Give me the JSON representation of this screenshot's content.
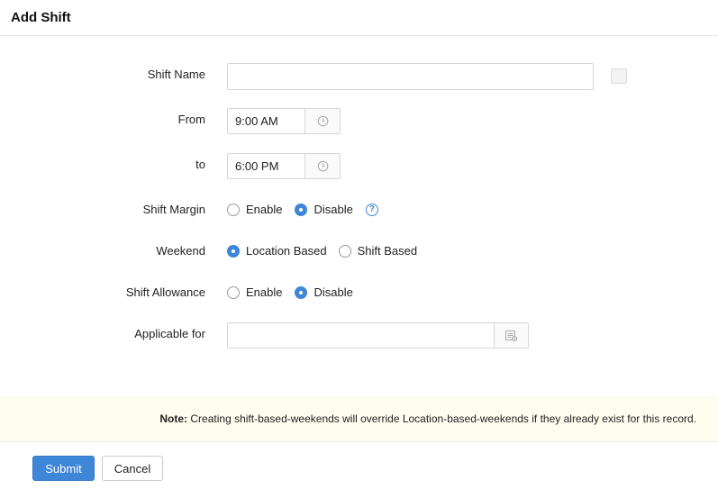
{
  "header": {
    "title": "Add Shift"
  },
  "form": {
    "shift_name": {
      "label": "Shift Name",
      "value": ""
    },
    "from": {
      "label": "From",
      "value": "9:00 AM",
      "icon": "clock-icon"
    },
    "to": {
      "label": "to",
      "value": "6:00 PM",
      "icon": "clock-icon"
    },
    "shift_margin": {
      "label": "Shift Margin",
      "options": [
        "Enable",
        "Disable"
      ],
      "selected": "Disable",
      "help_icon": "question-icon",
      "help_glyph": "?"
    },
    "weekend": {
      "label": "Weekend",
      "options": [
        "Location Based",
        "Shift Based"
      ],
      "selected": "Location Based"
    },
    "shift_allowance": {
      "label": "Shift Allowance",
      "options": [
        "Enable",
        "Disable"
      ],
      "selected": "Disable"
    },
    "applicable_for": {
      "label": "Applicable for",
      "value": "",
      "icon": "list-picker-icon"
    }
  },
  "note": {
    "prefix": "Note:",
    "text": " Creating shift-based-weekends will override Location-based-weekends if they already exist for this record."
  },
  "actions": {
    "submit_label": "Submit",
    "cancel_label": "Cancel"
  },
  "colors": {
    "accent": "#3d86d8",
    "note_bg": "#fdfdf0"
  }
}
